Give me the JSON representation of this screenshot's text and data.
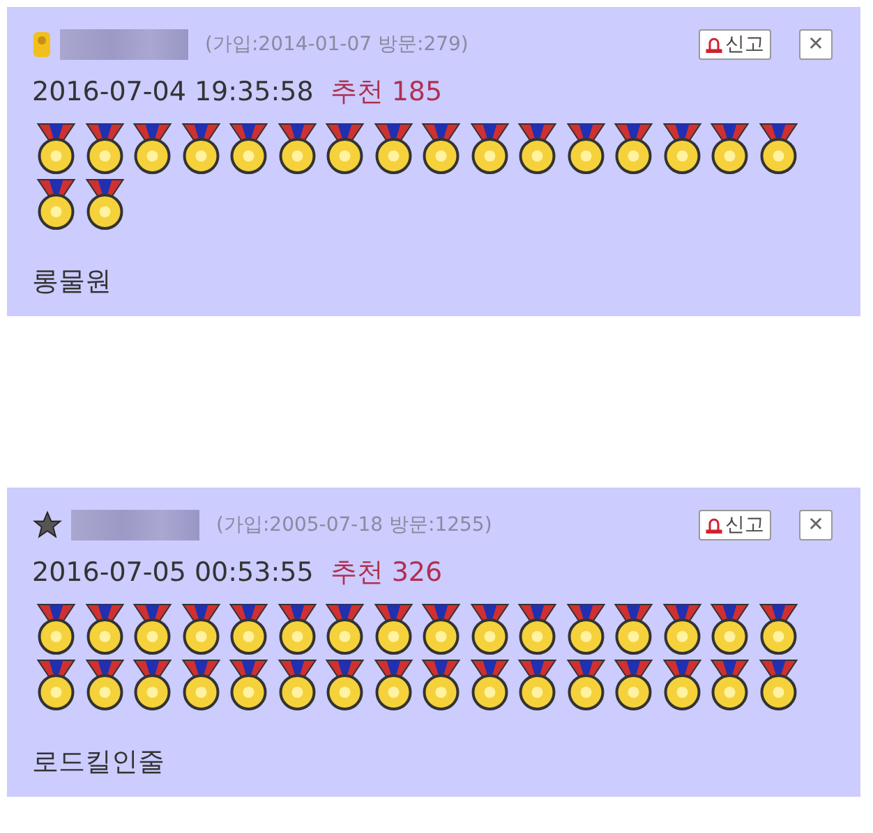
{
  "comments": [
    {
      "user_icon": {
        "kind": "badge"
      },
      "meta": "(가입:2014-01-07 방문:279)",
      "report_label": "신고",
      "close_label": "✕",
      "datetime": "2016-07-04 19:35:58",
      "recommend_label": "추천",
      "recommend_count": "185",
      "medals": [
        {
          "kind": "gold"
        },
        {
          "kind": "gold"
        },
        {
          "kind": "gold"
        },
        {
          "kind": "gold"
        },
        {
          "kind": "gold"
        },
        {
          "kind": "gold"
        },
        {
          "kind": "gold"
        },
        {
          "kind": "gold"
        },
        {
          "kind": "gold"
        },
        {
          "kind": "gold"
        },
        {
          "kind": "gold"
        },
        {
          "kind": "gold"
        },
        {
          "kind": "gold"
        },
        {
          "kind": "gold"
        },
        {
          "kind": "gold"
        },
        {
          "kind": "gold"
        },
        {
          "kind": "gold"
        },
        {
          "kind": "gold"
        }
      ],
      "body": "롱물원"
    },
    {
      "user_icon": {
        "kind": "star"
      },
      "meta": "(가입:2005-07-18 방문:1255)",
      "report_label": "신고",
      "close_label": "✕",
      "datetime": "2016-07-05 00:53:55",
      "recommend_label": "추천",
      "recommend_count": "326",
      "medals": [
        {
          "kind": "gold"
        },
        {
          "kind": "gold"
        },
        {
          "kind": "gold"
        },
        {
          "kind": "gold"
        },
        {
          "kind": "gold"
        },
        {
          "kind": "gold"
        },
        {
          "kind": "gold"
        },
        {
          "kind": "gold"
        },
        {
          "kind": "gold"
        },
        {
          "kind": "gold"
        },
        {
          "kind": "gold"
        },
        {
          "kind": "gold"
        },
        {
          "kind": "gold"
        },
        {
          "kind": "gold"
        },
        {
          "kind": "gold"
        },
        {
          "kind": "gold"
        },
        {
          "kind": "gold"
        },
        {
          "kind": "gold"
        },
        {
          "kind": "gold"
        },
        {
          "kind": "gold"
        },
        {
          "kind": "gold"
        },
        {
          "kind": "gold"
        },
        {
          "kind": "gold"
        },
        {
          "kind": "gold"
        },
        {
          "kind": "gold"
        },
        {
          "kind": "gold"
        },
        {
          "kind": "gold"
        },
        {
          "kind": "gold"
        },
        {
          "kind": "gold"
        },
        {
          "kind": "gold"
        },
        {
          "kind": "gold"
        },
        {
          "kind": "gold"
        }
      ],
      "body": "로드킬인줄"
    }
  ]
}
